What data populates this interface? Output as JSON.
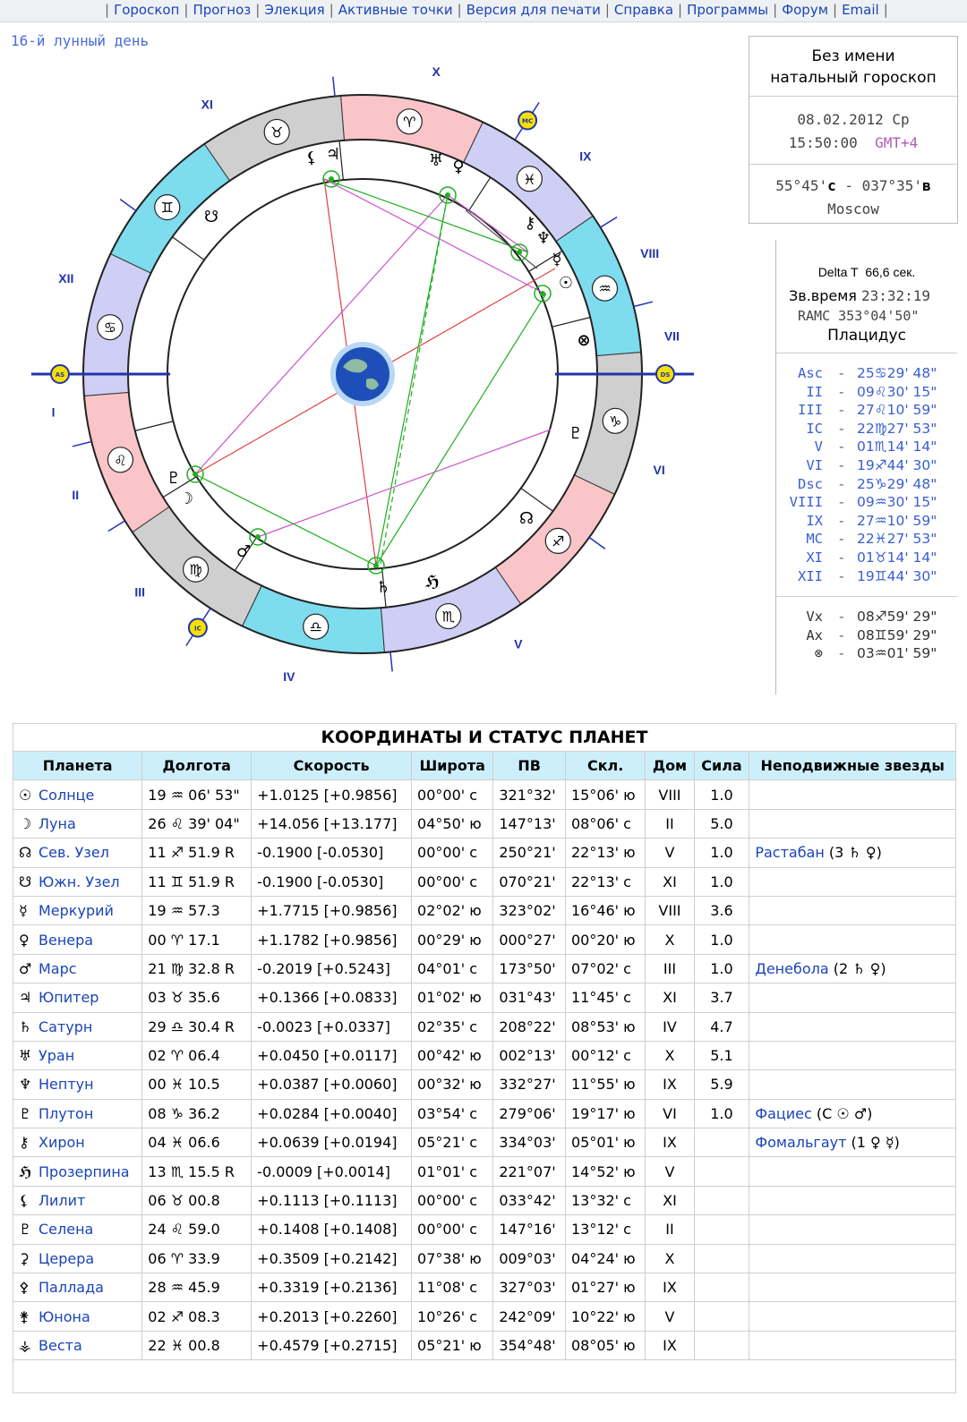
{
  "nav": {
    "items": [
      "Гороскоп",
      "Прогноз",
      "Элекция",
      "Активные точки",
      "Версия для печати",
      "Справка",
      "Программы",
      "Форум",
      "Email"
    ]
  },
  "lunar_day": "16-й лунный день",
  "info": {
    "name": "Без имени",
    "type": "натальный гороскоп",
    "date": "08.02.2012 Ср",
    "time": "15:50:00",
    "gmt": "GMT+4",
    "coords_pre": "55°45'",
    "coords_s": "с",
    "coords_mid": " - 037°35'",
    "coords_v": "в",
    "city": "Moscow"
  },
  "info2": {
    "delta_label": "Delta T",
    "delta_value": "66,6 сек.",
    "sid_label": "Зв.время",
    "sid_value": "23:32:19",
    "ramc": "RAMC 353°04'50\"",
    "system": "Плацидус"
  },
  "houses": [
    {
      "name": "Asc",
      "sign": "♋",
      "deg": "25",
      "min": "29' 48\""
    },
    {
      "name": "II",
      "sign": "♌",
      "deg": "09",
      "min": "30' 15\""
    },
    {
      "name": "III",
      "sign": "♌",
      "deg": "27",
      "min": "10' 59\""
    },
    {
      "name": "IC",
      "sign": "♍",
      "deg": "22",
      "min": "27' 53\""
    },
    {
      "name": "V",
      "sign": "♏",
      "deg": "01",
      "min": "14' 14\""
    },
    {
      "name": "VI",
      "sign": "♐",
      "deg": "19",
      "min": "44' 30\""
    },
    {
      "name": "Dsc",
      "sign": "♑",
      "deg": "25",
      "min": "29' 48\""
    },
    {
      "name": "VIII",
      "sign": "♒",
      "deg": "09",
      "min": "30' 15\""
    },
    {
      "name": "IX",
      "sign": "♒",
      "deg": "27",
      "min": "10' 59\""
    },
    {
      "name": "MC",
      "sign": "♓",
      "deg": "22",
      "min": "27' 53\""
    },
    {
      "name": "XI",
      "sign": "♉",
      "deg": "01",
      "min": "14' 14\""
    },
    {
      "name": "XII",
      "sign": "♊",
      "deg": "19",
      "min": "44' 30\""
    }
  ],
  "points": [
    {
      "name": "Vx",
      "sign": "♐",
      "deg": "08",
      "min": "59' 29\""
    },
    {
      "name": "Ax",
      "sign": "♊",
      "deg": "08",
      "min": "59' 29\""
    },
    {
      "name": "⊗",
      "sign": "♒",
      "deg": "03",
      "min": "01' 59\""
    }
  ],
  "wheel": {
    "house_labels": [
      "I",
      "II",
      "III",
      "IV",
      "V",
      "VI",
      "VII",
      "VIII",
      "IX",
      "X",
      "XI",
      "XII"
    ],
    "asc": "AS",
    "ds": "DS",
    "mc": "MC",
    "ic": "IC"
  },
  "table": {
    "caption": "КООРДИНАТЫ И СТАТУС ПЛАНЕТ",
    "headers": [
      "Планета",
      "Долгота",
      "Скорость",
      "Широта",
      "ПВ",
      "Скл.",
      "Дом",
      "Сила",
      "Неподвижные звезды"
    ],
    "rows": [
      {
        "sym": "☉",
        "name": "Солнце",
        "lon": "19 ♒ 06' 53\"",
        "speed": "+1.0125  [+0.9856]",
        "lat": "00°00' с",
        "pv": "321°32'",
        "decl": "15°06' ю",
        "house": "VIII",
        "power": "1.0",
        "star": ""
      },
      {
        "sym": "☽",
        "name": "Луна",
        "lon": "26 ♌ 39' 04\"",
        "speed": "+14.056  [+13.177]",
        "lat": "04°50' ю",
        "pv": "147°13'",
        "decl": "08°06' с",
        "house": "II",
        "power": "5.0",
        "star": ""
      },
      {
        "sym": "☊",
        "name": "Сев. Узел",
        "lon": "11 ♐ 51.9  R",
        "speed": "-0.1900  [-0.0530]",
        "lat": "00°00' с",
        "pv": "250°21'",
        "decl": "22°13' ю",
        "house": "V",
        "power": "1.0",
        "star": "Растабан (3 ♄ ♀)"
      },
      {
        "sym": "☋",
        "name": "Южн. Узел",
        "lon": "11 ♊ 51.9  R",
        "speed": "-0.1900  [-0.0530]",
        "lat": "00°00' с",
        "pv": "070°21'",
        "decl": "22°13' с",
        "house": "XI",
        "power": "1.0",
        "star": ""
      },
      {
        "sym": "☿",
        "name": "Меркурий",
        "lon": "19 ♒ 57.3",
        "speed": "+1.7715  [+0.9856]",
        "lat": "02°02' ю",
        "pv": "323°02'",
        "decl": "16°46' ю",
        "house": "VIII",
        "power": "3.6",
        "star": ""
      },
      {
        "sym": "♀",
        "name": "Венера",
        "lon": "00 ♈ 17.1",
        "speed": "+1.1782  [+0.9856]",
        "lat": "00°29' ю",
        "pv": "000°27'",
        "decl": "00°20' ю",
        "house": "X",
        "power": "1.0",
        "star": ""
      },
      {
        "sym": "♂",
        "name": "Марс",
        "lon": "21 ♍ 32.8  R",
        "speed": "-0.2019  [+0.5243]",
        "lat": "04°01' с",
        "pv": "173°50'",
        "decl": "07°02' с",
        "house": "III",
        "power": "1.0",
        "star": "Денебола (2 ♄ ♀)"
      },
      {
        "sym": "♃",
        "name": "Юпитер",
        "lon": "03 ♉ 35.6",
        "speed": "+0.1366  [+0.0833]",
        "lat": "01°02' ю",
        "pv": "031°43'",
        "decl": "11°45' с",
        "house": "XI",
        "power": "3.7",
        "star": ""
      },
      {
        "sym": "♄",
        "name": "Сатурн",
        "lon": "29 ♎ 30.4  R",
        "speed": "-0.0023  [+0.0337]",
        "lat": "02°35' с",
        "pv": "208°22'",
        "decl": "08°53' ю",
        "house": "IV",
        "power": "4.7",
        "star": ""
      },
      {
        "sym": "♅",
        "name": "Уран",
        "lon": "02 ♈ 06.4",
        "speed": "+0.0450  [+0.0117]",
        "lat": "00°42' ю",
        "pv": "002°13'",
        "decl": "00°12' с",
        "house": "X",
        "power": "5.1",
        "star": ""
      },
      {
        "sym": "♆",
        "name": "Нептун",
        "lon": "00 ♓ 10.5",
        "speed": "+0.0387  [+0.0060]",
        "lat": "00°32' ю",
        "pv": "332°27'",
        "decl": "11°55' ю",
        "house": "IX",
        "power": "5.9",
        "star": ""
      },
      {
        "sym": "♇",
        "name": "Плутон",
        "lon": "08 ♑ 36.2",
        "speed": "+0.0284  [+0.0040]",
        "lat": "03°54' с",
        "pv": "279°06'",
        "decl": "19°17' ю",
        "house": "VI",
        "power": "1.0",
        "star": "Фациес (С ☉ ♂)"
      },
      {
        "sym": "⚷",
        "name": "Хирон",
        "lon": "04 ♓ 06.6",
        "speed": "+0.0639  [+0.0194]",
        "lat": "05°21' с",
        "pv": "334°03'",
        "decl": "05°01' ю",
        "house": "IX",
        "power": "",
        "star": "Фомальгаут (1 ♀ ☿)"
      },
      {
        "sym": "ℌ",
        "name": "Прозерпина",
        "lon": "13 ♏ 15.5  R",
        "speed": "-0.0009  [+0.0014]",
        "lat": "01°01' с",
        "pv": "221°07'",
        "decl": "14°52' ю",
        "house": "V",
        "power": "",
        "star": ""
      },
      {
        "sym": "⚸",
        "name": "Лилит",
        "lon": "06 ♉ 00.8",
        "speed": "+0.1113  [+0.1113]",
        "lat": "00°00' с",
        "pv": "033°42'",
        "decl": "13°32' с",
        "house": "XI",
        "power": "",
        "star": ""
      },
      {
        "sym": "♇",
        "name": "Селена",
        "lon": "24 ♌ 59.0",
        "speed": "+0.1408  [+0.1408]",
        "lat": "00°00' с",
        "pv": "147°16'",
        "decl": "13°12' с",
        "house": "II",
        "power": "",
        "star": ""
      },
      {
        "sym": "⚳",
        "name": "Церера",
        "lon": "06 ♈ 33.9",
        "speed": "+0.3509  [+0.2142]",
        "lat": "07°38' ю",
        "pv": "009°03'",
        "decl": "04°24' ю",
        "house": "X",
        "power": "",
        "star": ""
      },
      {
        "sym": "⚴",
        "name": "Паллада",
        "lon": "28 ♒ 45.9",
        "speed": "+0.3319  [+0.2136]",
        "lat": "11°08' с",
        "pv": "327°03'",
        "decl": "01°27' ю",
        "house": "IX",
        "power": "",
        "star": ""
      },
      {
        "sym": "⚵",
        "name": "Юнона",
        "lon": "02 ♐ 08.3",
        "speed": "+0.2013  [+0.2260]",
        "lat": "10°26' с",
        "pv": "242°09'",
        "decl": "10°22' ю",
        "house": "V",
        "power": "",
        "star": ""
      },
      {
        "sym": "⚶",
        "name": "Веста",
        "lon": "22 ♓ 00.8",
        "speed": "+0.4579  [+0.2715]",
        "lat": "05°21' ю",
        "pv": "354°48'",
        "decl": "08°05' ю",
        "house": "IX",
        "power": "",
        "star": ""
      }
    ]
  },
  "colors": {
    "link": "#1a44b8",
    "header_bg": "#cdeffb",
    "mono_blue": "#4a6cd6"
  }
}
